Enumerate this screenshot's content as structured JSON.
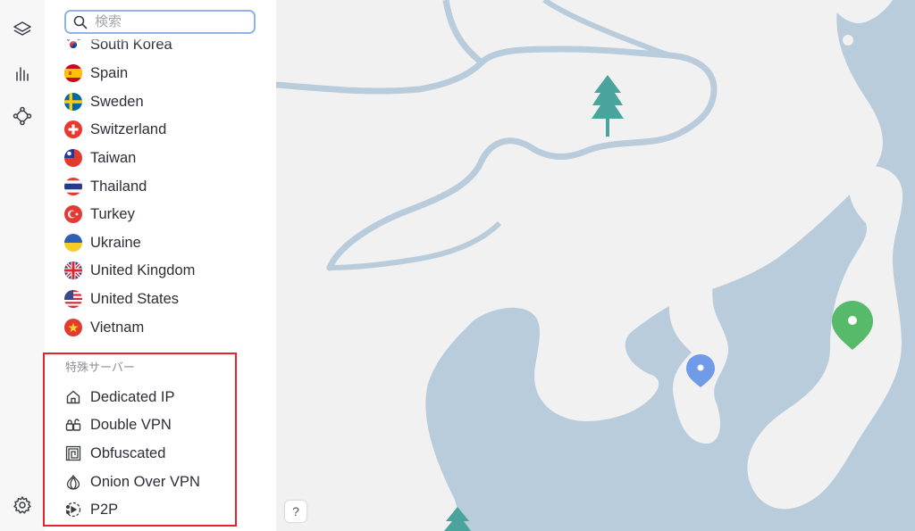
{
  "search": {
    "placeholder": "検索"
  },
  "countries": [
    {
      "name": "South Korea",
      "flag": "south-korea"
    },
    {
      "name": "Spain",
      "flag": "spain"
    },
    {
      "name": "Sweden",
      "flag": "sweden"
    },
    {
      "name": "Switzerland",
      "flag": "switzerland"
    },
    {
      "name": "Taiwan",
      "flag": "taiwan"
    },
    {
      "name": "Thailand",
      "flag": "thailand"
    },
    {
      "name": "Turkey",
      "flag": "turkey"
    },
    {
      "name": "Ukraine",
      "flag": "ukraine"
    },
    {
      "name": "United Kingdom",
      "flag": "united-kingdom"
    },
    {
      "name": "United States",
      "flag": "united-states"
    },
    {
      "name": "Vietnam",
      "flag": "vietnam"
    }
  ],
  "specialty": {
    "title": "特殊サーバー",
    "items": [
      {
        "label": "Dedicated IP",
        "icon": "house-icon"
      },
      {
        "label": "Double VPN",
        "icon": "double-lock-icon"
      },
      {
        "label": "Obfuscated",
        "icon": "obfuscated-icon"
      },
      {
        "label": "Onion Over VPN",
        "icon": "onion-icon"
      },
      {
        "label": "P2P",
        "icon": "p2p-icon"
      }
    ]
  },
  "help": {
    "label": "?"
  },
  "colors": {
    "water": "#b8ccdb",
    "land": "#f1f1f1",
    "highlight": "#e3252b",
    "pin_green": "#57b96a",
    "pin_blue": "#6f9be8",
    "tree": "#4aa39c"
  }
}
